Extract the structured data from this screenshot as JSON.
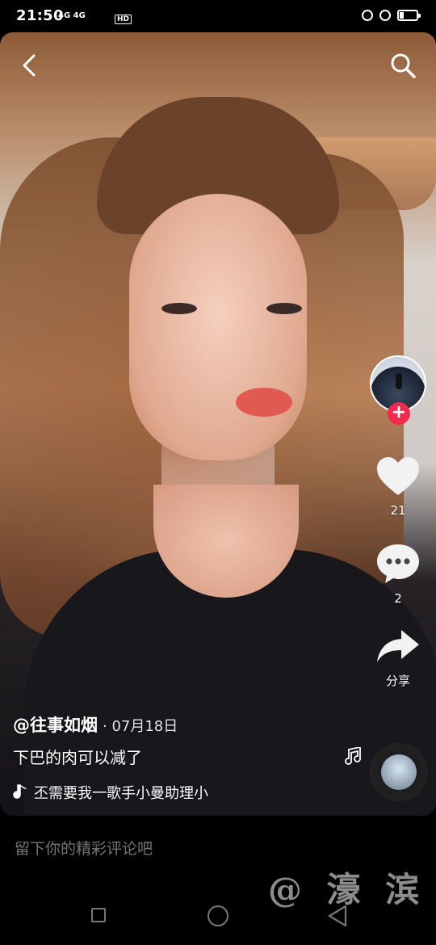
{
  "status_bar": {
    "time": "21:50",
    "network": "4G 4G",
    "hd": "HD"
  },
  "video": {
    "author": "@往事如烟",
    "date": "· 07月18日",
    "caption": "下巴的肉可以减了",
    "music": "丕需要我一歌手小曼助理小"
  },
  "actions": {
    "likes": "21",
    "comments": "2",
    "share_label": "分享"
  },
  "comment_bar": {
    "placeholder": "留下你的精彩评论吧"
  },
  "watermark": "@ 濠 滨",
  "icons": {
    "back": "chevron-left-icon",
    "search": "search-icon",
    "like": "heart-icon",
    "comment": "comment-bubble-icon",
    "share": "share-arrow-icon",
    "music": "music-note-icon"
  },
  "colors": {
    "follow_badge": "#ee2a4e",
    "background": "#000000"
  }
}
